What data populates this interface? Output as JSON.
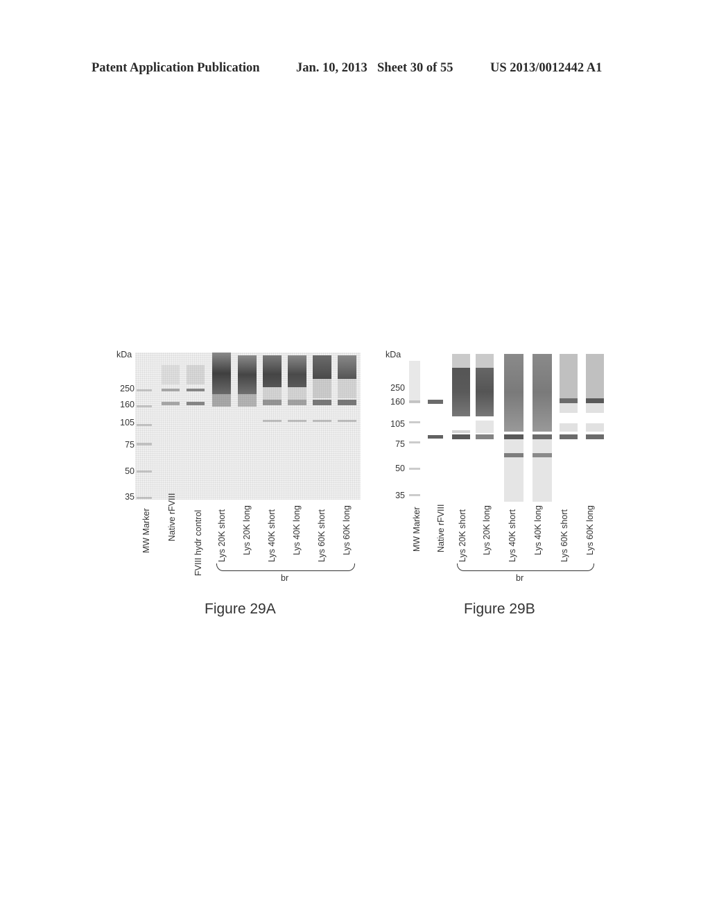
{
  "header": {
    "publication": "Patent Application Publication",
    "date": "Jan. 10, 2013",
    "sheet": "Sheet 30 of 55",
    "number": "US 2013/0012442 A1"
  },
  "figures": [
    {
      "id": "29A",
      "caption": "Figure 29A",
      "kda_label": "kDa",
      "markers": [
        "250",
        "160",
        "105",
        "75",
        "50",
        "35"
      ],
      "lanes": [
        "MW Marker",
        "Native rFVIII",
        "FVIII hydr control",
        "Lys 20K short",
        "Lys 20K long",
        "Lys 40K short",
        "Lys 40K long",
        "Lys 60K short",
        "Lys 60K long"
      ],
      "bracket_label": "br"
    },
    {
      "id": "29B",
      "caption": "Figure 29B",
      "kda_label": "kDa",
      "markers": [
        "250",
        "160",
        "105",
        "75",
        "50",
        "35"
      ],
      "lanes": [
        "MW Marker",
        "Native rFVIII",
        "Lys 20K short",
        "Lys 20K long",
        "Lys 40K short",
        "Lys 40K long",
        "Lys 60K short",
        "Lys 60K long"
      ],
      "bracket_label": "br"
    }
  ]
}
